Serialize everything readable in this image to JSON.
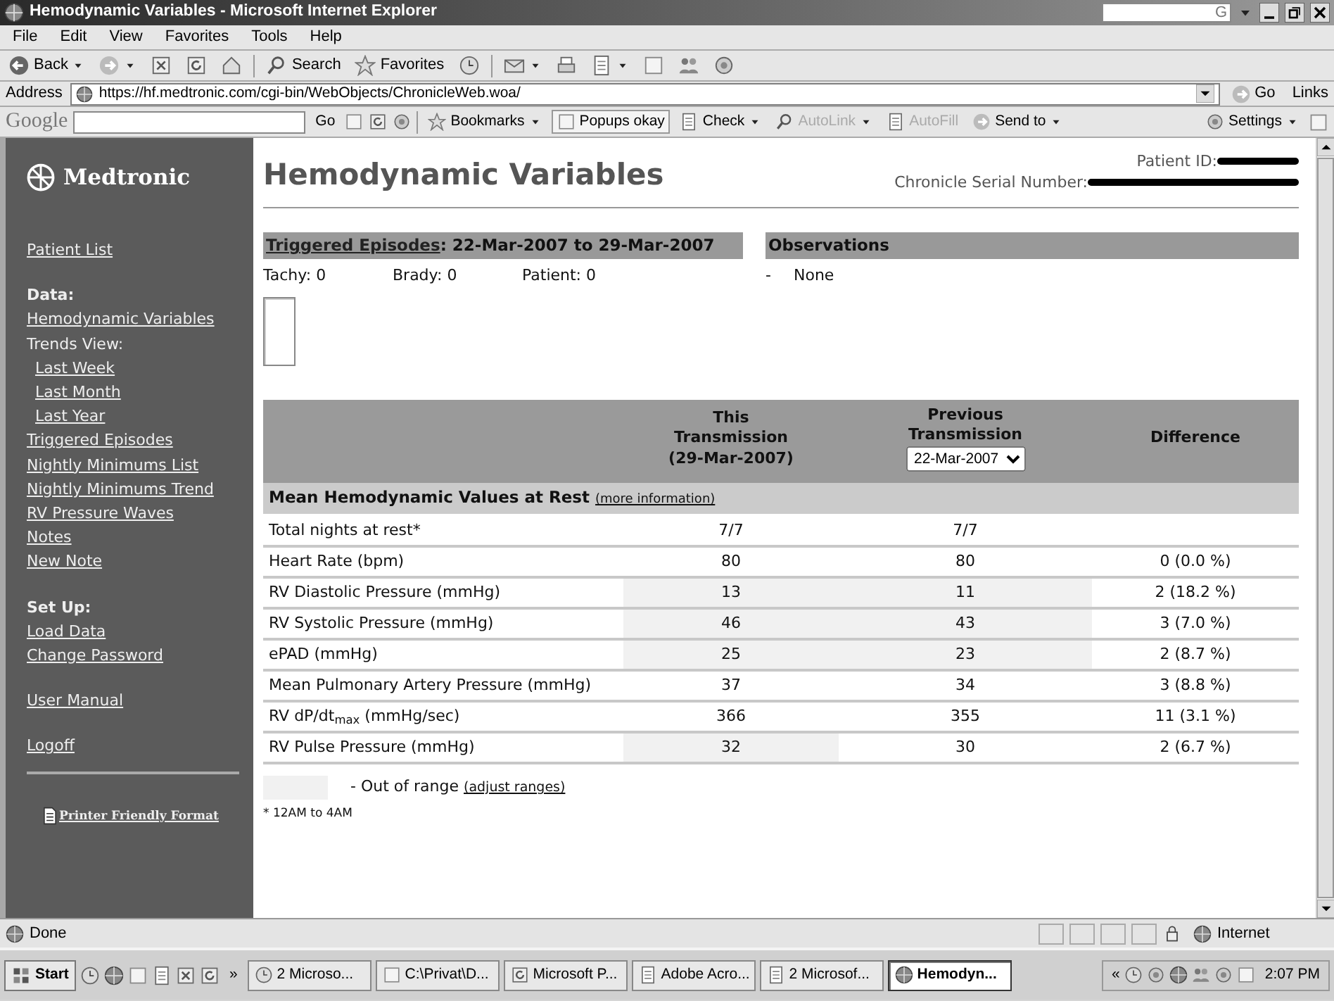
{
  "window": {
    "title": "Hemodynamic Variables - Microsoft Internet Explorer",
    "deskbar": "G"
  },
  "menu": [
    "File",
    "Edit",
    "View",
    "Favorites",
    "Tools",
    "Help"
  ],
  "toolbar": {
    "back": "Back",
    "search": "Search",
    "favorites": "Favorites"
  },
  "address": {
    "label": "Address",
    "url": "https://hf.medtronic.com/cgi-bin/WebObjects/ChronicleWeb.woa/",
    "go": "Go",
    "links": "Links"
  },
  "google_bar": {
    "logo": "Google",
    "go": "Go",
    "buttons": [
      {
        "label": "Bookmarks",
        "disabled": false,
        "caret": true
      },
      {
        "label": "Popups okay",
        "disabled": false,
        "caret": false
      },
      {
        "label": "Check",
        "disabled": false,
        "caret": true
      },
      {
        "label": "AutoLink",
        "disabled": true,
        "caret": true
      },
      {
        "label": "AutoFill",
        "disabled": true,
        "caret": false
      },
      {
        "label": "Send to",
        "disabled": false,
        "caret": true
      }
    ],
    "settings": "Settings"
  },
  "sidebar": {
    "logo": "Medtronic",
    "sections": [
      {
        "items": [
          {
            "label": "Patient List",
            "kind": "link"
          }
        ]
      },
      {
        "heading": "Data:",
        "items": [
          {
            "label": "Hemodynamic Variables",
            "kind": "link"
          },
          {
            "label": "Trends View:",
            "kind": "label",
            "children": [
              {
                "label": "Last Week",
                "kind": "link"
              },
              {
                "label": "Last Month",
                "kind": "link"
              },
              {
                "label": "Last Year",
                "kind": "link"
              }
            ]
          },
          {
            "label": "Triggered Episodes",
            "kind": "link"
          },
          {
            "label": "Nightly Minimums List",
            "kind": "link"
          },
          {
            "label": "Nightly Minimums Trend",
            "kind": "link"
          },
          {
            "label": "RV Pressure Waves",
            "kind": "link"
          },
          {
            "label": "Notes",
            "kind": "link"
          },
          {
            "label": "New Note",
            "kind": "link"
          }
        ]
      },
      {
        "heading": "Set Up:",
        "items": [
          {
            "label": "Load Data",
            "kind": "link"
          },
          {
            "label": "Change Password",
            "kind": "link"
          }
        ]
      },
      {
        "items": [
          {
            "label": "User Manual",
            "kind": "link"
          }
        ]
      },
      {
        "items": [
          {
            "label": "Logoff",
            "kind": "link"
          }
        ]
      }
    ],
    "printer": "Printer Friendly Format"
  },
  "page": {
    "title": "Hemodynamic Variables",
    "patient_id_label": "Patient ID:",
    "serial_label": "Chronicle Serial Number:"
  },
  "triggered": {
    "link": "Triggered Episodes",
    "range": ": 22-Mar-2007 to 29-Mar-2007",
    "counts": [
      "Tachy: 0",
      "Brady: 0",
      "Patient: 0"
    ]
  },
  "observations": {
    "heading": "Observations",
    "items": [
      {
        "bullet": "-",
        "text": "None"
      }
    ]
  },
  "table": {
    "columns": [
      {
        "lines": [
          "This",
          "Transmission",
          "(29-Mar-2007)"
        ]
      },
      {
        "lines": [
          "Previous",
          "Transmission"
        ],
        "select": "22-Mar-2007"
      },
      {
        "lines": [
          "Difference"
        ]
      }
    ],
    "section": {
      "title": "Mean Hemodynamic Values at Rest",
      "link": "(more information)"
    },
    "rows": [
      {
        "label": "Total nights at rest*",
        "cells": [
          {
            "text": "7/7",
            "out_of_range": false
          },
          {
            "text": "7/7",
            "out_of_range": false
          }
        ]
      },
      {
        "label": "Heart Rate (bpm)",
        "cells": [
          {
            "text": "80",
            "out_of_range": false
          },
          {
            "text": "80",
            "out_of_range": false
          },
          {
            "text": "0 (0.0 %)",
            "out_of_range": false
          }
        ]
      },
      {
        "label": "RV Diastolic Pressure (mmHg)",
        "cells": [
          {
            "text": "13",
            "out_of_range": true
          },
          {
            "text": "11",
            "out_of_range": true
          },
          {
            "text": "2 (18.2 %)",
            "out_of_range": false
          }
        ]
      },
      {
        "label": "RV Systolic Pressure (mmHg)",
        "cells": [
          {
            "text": "46",
            "out_of_range": true
          },
          {
            "text": "43",
            "out_of_range": true
          },
          {
            "text": "3 (7.0 %)",
            "out_of_range": false
          }
        ]
      },
      {
        "label": "ePAD (mmHg)",
        "cells": [
          {
            "text": "25",
            "out_of_range": true
          },
          {
            "text": "23",
            "out_of_range": true
          },
          {
            "text": "2 (8.7 %)",
            "out_of_range": false
          }
        ]
      },
      {
        "label": "Mean Pulmonary Artery Pressure (mmHg)",
        "cells": [
          {
            "text": "37",
            "out_of_range": false
          },
          {
            "text": "34",
            "out_of_range": false
          },
          {
            "text": "3 (8.8 %)",
            "out_of_range": false
          }
        ]
      },
      {
        "label": "RV dP/dt$_{max}$ (mmHg/sec)",
        "cells": [
          {
            "text": "366",
            "out_of_range": false
          },
          {
            "text": "355",
            "out_of_range": false
          },
          {
            "text": "11 (3.1 %)",
            "out_of_range": false
          }
        ]
      },
      {
        "label": "RV Pulse Pressure (mmHg)",
        "cells": [
          {
            "text": "32",
            "out_of_range": true
          },
          {
            "text": "30",
            "out_of_range": false
          },
          {
            "text": "2 (6.7 %)",
            "out_of_range": false
          }
        ]
      }
    ]
  },
  "legend": {
    "text": "- Out of range",
    "link": "(adjust ranges)"
  },
  "footnote": "* 12AM to 4AM",
  "status_bar": {
    "text": "Done",
    "zone": "Internet"
  },
  "taskbar": {
    "start": "Start",
    "overflow": "»",
    "tasks": [
      {
        "label": "2 Microso...",
        "selected": false
      },
      {
        "label": "C:\\Privat\\D...",
        "selected": false
      },
      {
        "label": "Microsoft P...",
        "selected": false
      },
      {
        "label": "Adobe Acro...",
        "selected": false
      },
      {
        "label": "2 Microsof...",
        "selected": false
      },
      {
        "label": "Hemodyn...",
        "selected": true
      }
    ],
    "tray_overflow": "«",
    "clock": "2:07 PM"
  }
}
